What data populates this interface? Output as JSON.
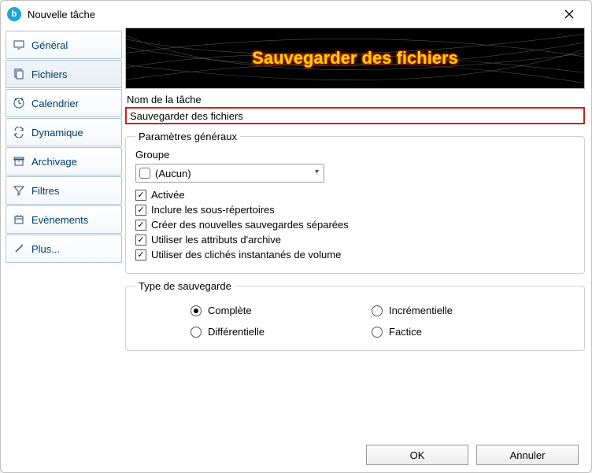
{
  "window": {
    "title": "Nouvelle tâche"
  },
  "sidebar": {
    "items": [
      {
        "id": "general",
        "label": "Général",
        "icon": "monitor-icon"
      },
      {
        "id": "fichiers",
        "label": "Fichiers",
        "icon": "files-icon",
        "selected": true
      },
      {
        "id": "calendrier",
        "label": "Calendrier",
        "icon": "clock-icon"
      },
      {
        "id": "dynamique",
        "label": "Dynamique",
        "icon": "loop-icon"
      },
      {
        "id": "archivage",
        "label": "Archivage",
        "icon": "box-icon"
      },
      {
        "id": "filtres",
        "label": "Filtres",
        "icon": "funnel-icon"
      },
      {
        "id": "evenements",
        "label": "Evènements",
        "icon": "calendar-icon"
      },
      {
        "id": "plus",
        "label": "Plus...",
        "icon": "wand-icon"
      }
    ]
  },
  "banner": {
    "text": "Sauvegarder des fichiers"
  },
  "task_name": {
    "label": "Nom de la tâche",
    "value": "Sauvegarder des fichiers"
  },
  "general_params": {
    "legend": "Paramètres généraux",
    "group_label": "Groupe",
    "group_value": "(Aucun)",
    "checkboxes": [
      {
        "label": "Activée",
        "checked": true
      },
      {
        "label": "Inclure les sous-répertoires",
        "checked": true
      },
      {
        "label": "Créer des nouvelles sauvegardes séparées",
        "checked": true
      },
      {
        "label": "Utiliser les attributs d'archive",
        "checked": true
      },
      {
        "label": "Utiliser des clichés instantanés de volume",
        "checked": true
      }
    ]
  },
  "backup_type": {
    "legend": "Type de sauvegarde",
    "options": [
      {
        "label": "Complète",
        "selected": true
      },
      {
        "label": "Incrémentielle",
        "selected": false
      },
      {
        "label": "Différentielle",
        "selected": false
      },
      {
        "label": "Factice",
        "selected": false
      }
    ]
  },
  "buttons": {
    "ok": "OK",
    "cancel": "Annuler"
  }
}
